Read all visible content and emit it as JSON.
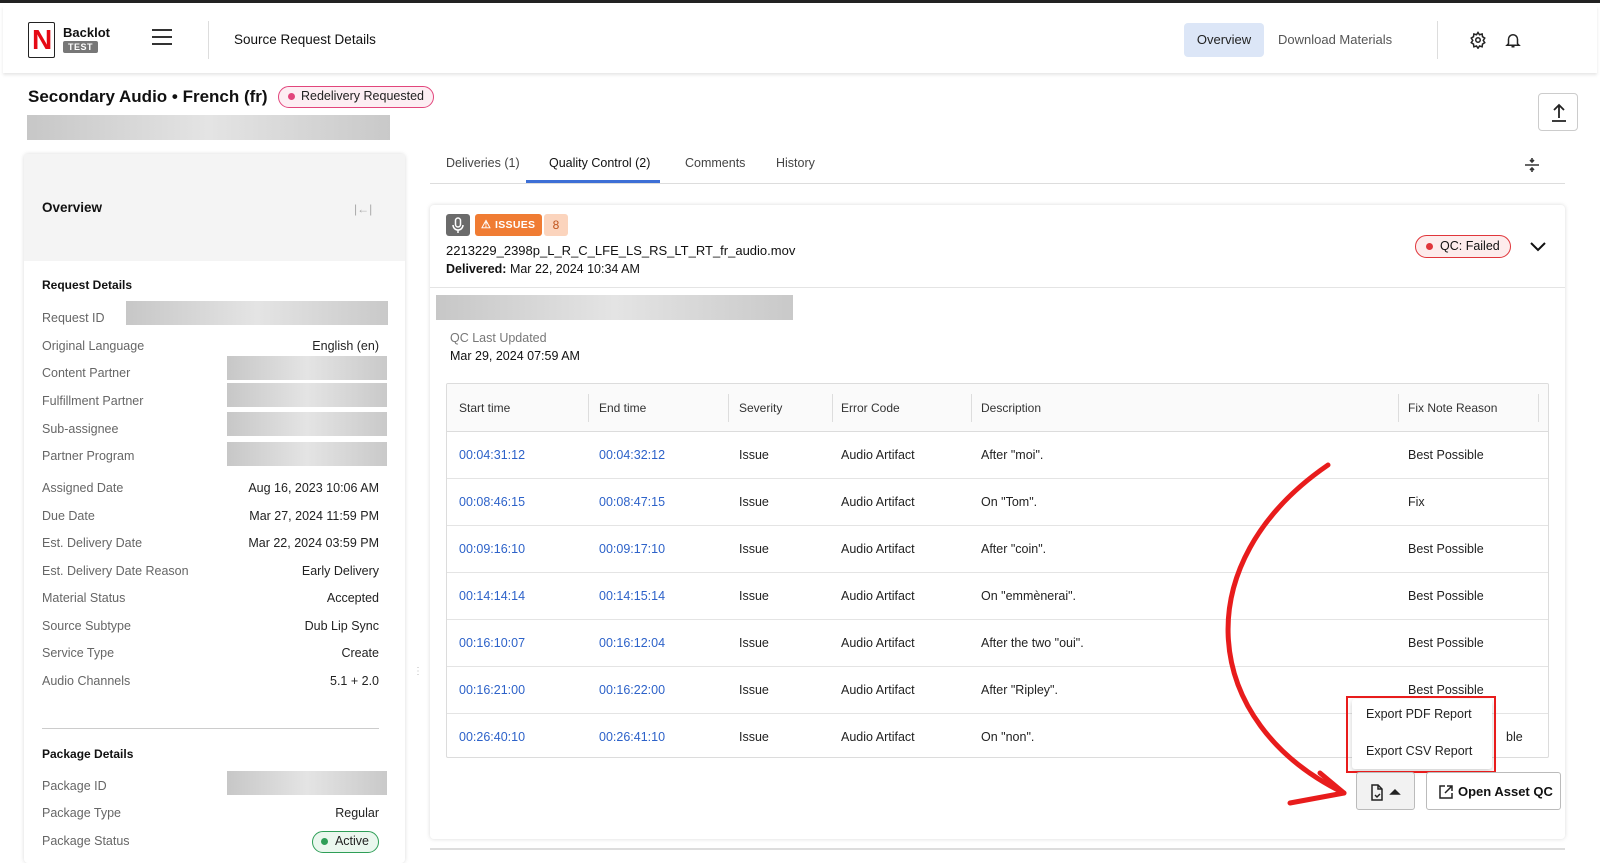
{
  "nav": {
    "brand": "Backlot",
    "brand_tag": "TEST",
    "page_title": "Source Request Details",
    "tabs": [
      "Overview",
      "Download Materials"
    ],
    "icons": [
      "menu-icon",
      "gear-icon",
      "bell-icon"
    ]
  },
  "header": {
    "title": "Secondary Audio • French (fr)",
    "status": "Redelivery Requested"
  },
  "overview": {
    "title": "Overview",
    "request_details_title": "Request Details",
    "request_details": [
      {
        "label": "Request ID",
        "value": ""
      },
      {
        "label": "Original Language",
        "value": "English (en)"
      },
      {
        "label": "Content Partner",
        "value": ""
      },
      {
        "label": "Fulfillment Partner",
        "value": ""
      },
      {
        "label": "Sub-assignee",
        "value": ""
      },
      {
        "label": "Partner Program",
        "value": ""
      },
      {
        "label": "Assigned Date",
        "value": "Aug 16, 2023 10:06 AM"
      },
      {
        "label": "Due Date",
        "value": "Mar 27, 2024 11:59 PM"
      },
      {
        "label": "Est. Delivery Date",
        "value": "Mar 22, 2024 03:59 PM"
      },
      {
        "label": "Est. Delivery Date Reason",
        "value": "Early Delivery"
      },
      {
        "label": "Material Status",
        "value": "Accepted"
      },
      {
        "label": "Source Subtype",
        "value": "Dub Lip Sync"
      },
      {
        "label": "Service Type",
        "value": "Create"
      },
      {
        "label": "Audio Channels",
        "value": "5.1 + 2.0"
      }
    ],
    "package_details_title": "Package Details",
    "package_details": [
      {
        "label": "Package ID",
        "value": ""
      },
      {
        "label": "Package Type",
        "value": "Regular"
      },
      {
        "label": "Package Status",
        "value": "Active"
      }
    ]
  },
  "tabs": [
    {
      "label": "Deliveries (1)",
      "active": false
    },
    {
      "label": "Quality Control (2)",
      "active": true
    },
    {
      "label": "Comments",
      "active": false
    },
    {
      "label": "History",
      "active": false
    }
  ],
  "qc_card": {
    "issues_label": "ISSUES",
    "issues_count": "8",
    "file_name": "2213229_2398p_L_R_C_LFE_LS_RS_LT_RT_fr_audio.mov",
    "delivered_label": "Delivered:",
    "delivered_value": "Mar 22, 2024 10:34 AM",
    "qc_status": "QC: Failed",
    "qc_last_updated_label": "QC Last Updated",
    "qc_last_updated_value": "Mar 29, 2024 07:59 AM"
  },
  "qc_table": {
    "columns": [
      "Start time",
      "End time",
      "Severity",
      "Error Code",
      "Description",
      "Fix Note Reason"
    ],
    "rows": [
      [
        "00:04:31:12",
        "00:04:32:12",
        "Issue",
        "Audio Artifact",
        "After \"moi\".",
        "Best Possible"
      ],
      [
        "00:08:46:15",
        "00:08:47:15",
        "Issue",
        "Audio Artifact",
        "On \"Tom\".",
        "Fix"
      ],
      [
        "00:09:16:10",
        "00:09:17:10",
        "Issue",
        "Audio Artifact",
        "After \"coin\".",
        "Best Possible"
      ],
      [
        "00:14:14:14",
        "00:14:15:14",
        "Issue",
        "Audio Artifact",
        "On \"emmènerai\".",
        "Best Possible"
      ],
      [
        "00:16:10:07",
        "00:16:12:04",
        "Issue",
        "Audio Artifact",
        "After the two \"oui\".",
        "Best Possible"
      ],
      [
        "00:16:21:00",
        "00:16:22:00",
        "Issue",
        "Audio Artifact",
        "After \"Ripley\".",
        "Best Possible"
      ],
      [
        "00:26:40:10",
        "00:26:41:10",
        "Issue",
        "Audio Artifact",
        "On \"non\".",
        "ble"
      ]
    ]
  },
  "export_menu": {
    "items": [
      "Export PDF Report",
      "Export CSV Report"
    ]
  },
  "buttons": {
    "open_asset_qc": "Open Asset QC"
  },
  "colors": {
    "accent": "#3d6fd6",
    "link": "#2d62c9",
    "failed": "#e0363b",
    "redelivery": "#e2457c",
    "active": "#2e9e57",
    "issues": "#f07c33",
    "annotation": "#e81c1c"
  }
}
